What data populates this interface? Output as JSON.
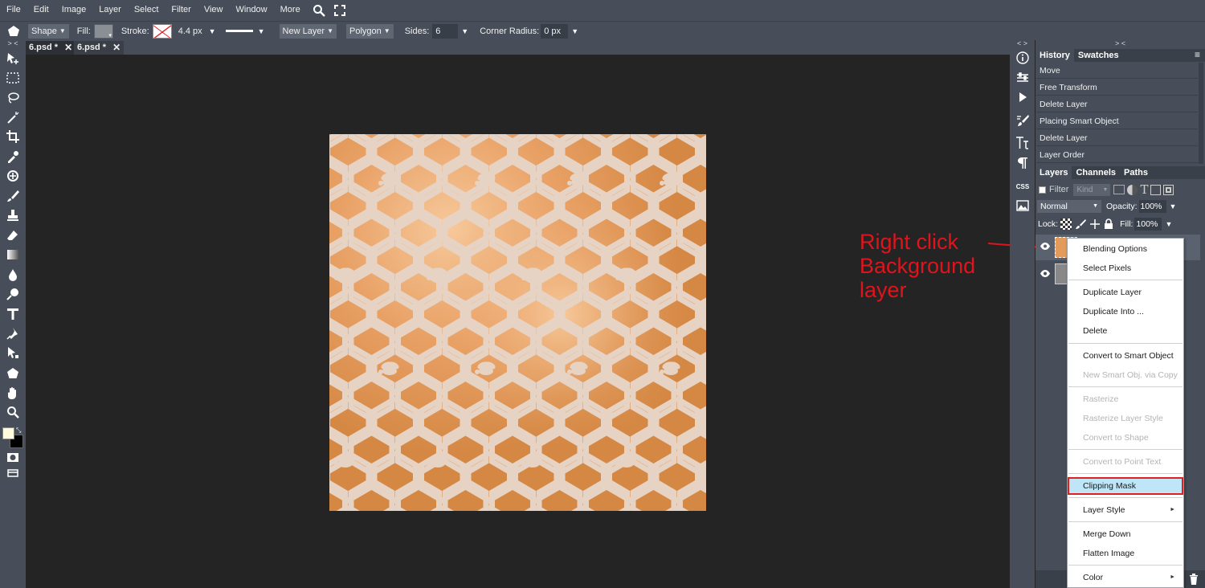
{
  "menubar": {
    "items": [
      "File",
      "Edit",
      "Image",
      "Layer",
      "Select",
      "Filter",
      "View",
      "Window",
      "More"
    ]
  },
  "options": {
    "shape_mode": "Shape",
    "fill_label": "Fill:",
    "stroke_label": "Stroke:",
    "stroke_width": "4.4 px",
    "layer_mode": "New Layer",
    "shape_type": "Polygon",
    "sides_label": "Sides:",
    "sides_value": "6",
    "corner_label": "Corner Radius:",
    "corner_value": "0 px"
  },
  "collapse_glyph": "> <",
  "right_collapse": "< >",
  "panel_collapse": "> <",
  "tabs": [
    {
      "label": "6.psd *"
    },
    {
      "label": "6.psd *"
    }
  ],
  "history_panel": {
    "tabs": [
      "History",
      "Swatches"
    ],
    "items": [
      "Move",
      "Free Transform",
      "Delete Layer",
      "Placing Smart Object",
      "Delete Layer",
      "Layer Order"
    ]
  },
  "layers_panel": {
    "tabs": [
      "Layers",
      "Channels",
      "Paths"
    ],
    "filter_label": "Filter",
    "kind_label": "Kind",
    "blend_mode": "Normal",
    "opacity_label": "Opacity:",
    "opacity_value": "100%",
    "lock_label": "Lock:",
    "fill_label": "Fill:",
    "fill_value": "100%"
  },
  "sidestrip": {
    "css_label": "CSS"
  },
  "context_menu": {
    "items": [
      {
        "label": "Blending Options"
      },
      {
        "label": "Select Pixels"
      },
      {
        "label": "Duplicate Layer"
      },
      {
        "label": "Duplicate Into ..."
      },
      {
        "label": "Delete"
      },
      {
        "label": "Convert to Smart Object"
      },
      {
        "label": "New Smart Obj. via Copy"
      },
      {
        "label": "Rasterize"
      },
      {
        "label": "Rasterize Layer Style"
      },
      {
        "label": "Convert to Shape"
      },
      {
        "label": "Convert to Point Text"
      },
      {
        "label": "Clipping Mask"
      },
      {
        "label": "Layer Style"
      },
      {
        "label": "Merge Down"
      },
      {
        "label": "Flatten Image"
      },
      {
        "label": "Color"
      }
    ]
  },
  "annotation": {
    "line1": "Right click",
    "line2": "Background",
    "line3": "layer"
  },
  "colors": {
    "accent_red": "#e0141c",
    "highlight": "#bfe6f7",
    "foreground": "#fffbdc",
    "background": "#000000"
  }
}
